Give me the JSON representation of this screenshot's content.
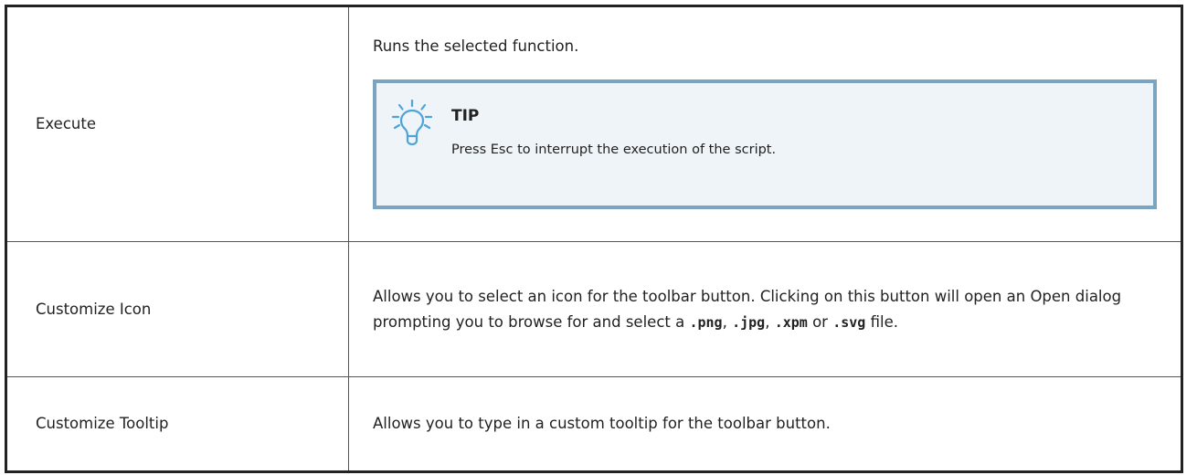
{
  "rows": [
    {
      "name": "Execute",
      "description": "Runs the selected function.",
      "tip": {
        "title": "TIP",
        "text": "Press Esc to interrupt the execution of the script.",
        "icon": "lightbulb-icon"
      }
    },
    {
      "name": "Customize Icon",
      "description_parts": {
        "intro": "Allows you to select an icon for the toolbar button. Clicking on this button will open an Open dialog prompting you to browse for and select a ",
        "ext_png": ".png",
        "sep1": ", ",
        "ext_jpg": ".jpg",
        "sep2": ", ",
        "ext_xpm": ".xpm",
        "sep3": " or ",
        "ext_svg": ".svg",
        "outro": " file."
      }
    },
    {
      "name": "Customize Tooltip",
      "description": "Allows you to type in a custom tooltip for the toolbar button."
    }
  ],
  "colors": {
    "tip_border": "#7ba4c0",
    "tip_background": "#eef4f8",
    "icon_stroke": "#4fa3d9",
    "table_border": "#222222"
  }
}
